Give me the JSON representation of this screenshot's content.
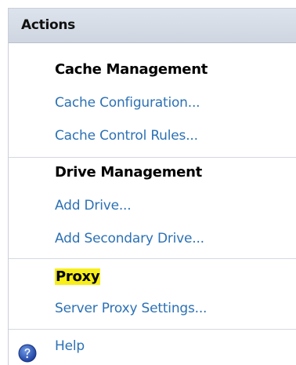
{
  "panel": {
    "title": "Actions"
  },
  "sections": [
    {
      "title": "Cache Management",
      "items": [
        "Cache Configuration...",
        "Cache Control Rules..."
      ]
    },
    {
      "title": "Drive Management",
      "items": [
        "Add Drive...",
        "Add Secondary Drive..."
      ]
    },
    {
      "title": "Proxy",
      "items": [
        "Server Proxy Settings..."
      ]
    }
  ],
  "help": {
    "label": "Help",
    "icon": "help-icon"
  },
  "colors": {
    "link": "#2c71b5",
    "highlight": "#f7ee1a",
    "header_bg": "#d6dce6"
  }
}
